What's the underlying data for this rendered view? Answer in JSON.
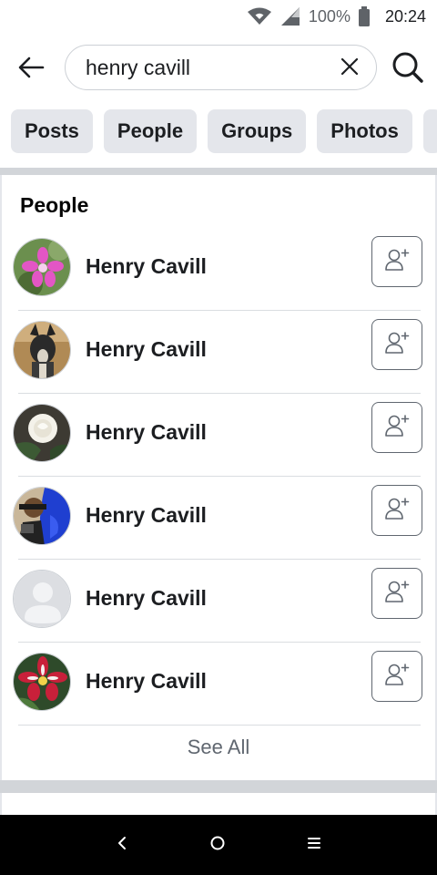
{
  "status_bar": {
    "battery_text": "100%",
    "time": "20:24",
    "icons": [
      "wifi-icon",
      "signal-icon",
      "battery-icon"
    ]
  },
  "search": {
    "value": "henry cavill",
    "back_icon": "arrow-left-icon",
    "clear_icon": "close-icon",
    "search_icon": "search-icon"
  },
  "filter_chips": [
    "Posts",
    "People",
    "Groups",
    "Photos"
  ],
  "people_section": {
    "title": "People",
    "results": [
      {
        "name": "Henry Cavill",
        "avatar": "pink-flower-photo",
        "action_icon": "add-friend-icon"
      },
      {
        "name": "Henry Cavill",
        "avatar": "dog-photo",
        "action_icon": "add-friend-icon"
      },
      {
        "name": "Henry Cavill",
        "avatar": "white-rose-photo",
        "action_icon": "add-friend-icon"
      },
      {
        "name": "Henry Cavill",
        "avatar": "person-blue-photo",
        "action_icon": "add-friend-icon"
      },
      {
        "name": "Henry Cavill",
        "avatar": "default-avatar-silhouette",
        "action_icon": "add-friend-icon"
      },
      {
        "name": "Henry Cavill",
        "avatar": "red-flower-photo",
        "action_icon": "add-friend-icon"
      }
    ],
    "see_all": "See All"
  },
  "colors": {
    "chip_bg": "#e4e6eb",
    "divider": "#d2d5d9",
    "text_primary": "#1c1e21",
    "text_secondary": "#606770"
  },
  "nav_bar": {
    "icons": [
      "nav-back-icon",
      "nav-home-icon",
      "nav-recents-icon"
    ]
  }
}
